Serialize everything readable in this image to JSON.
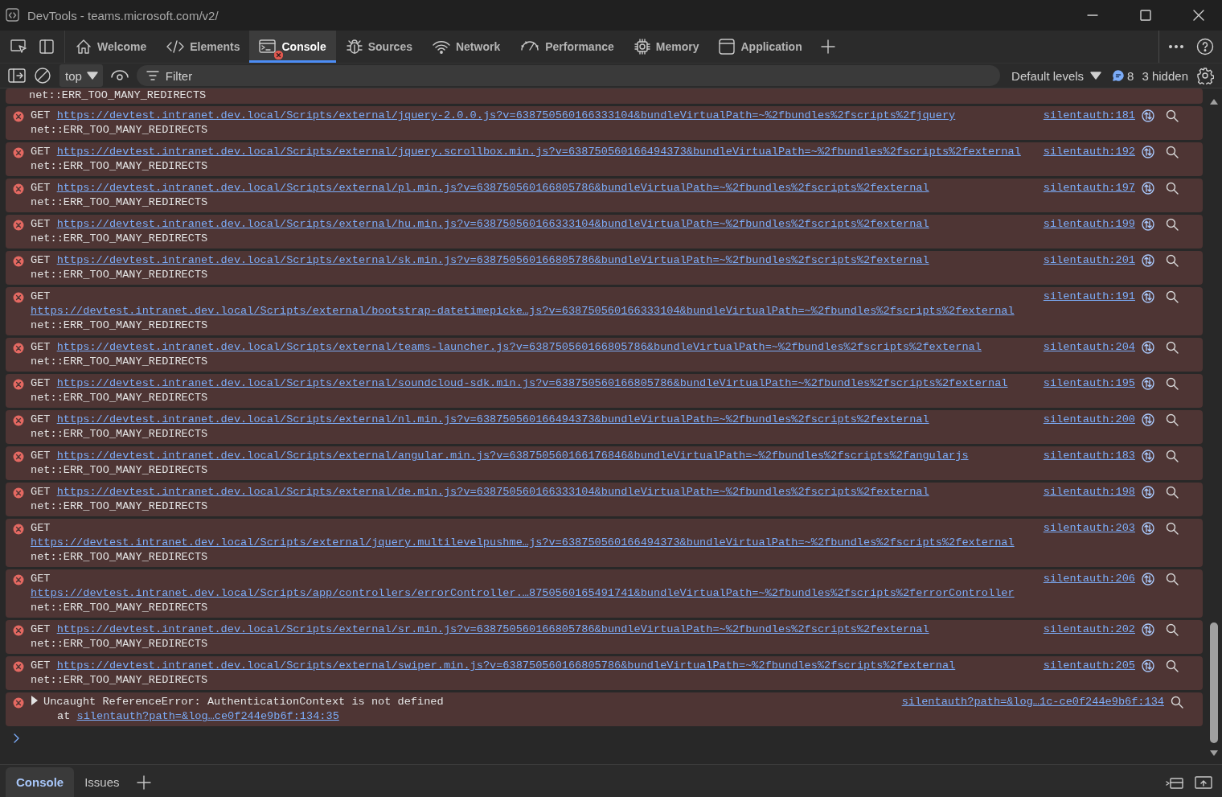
{
  "window": {
    "title": "DevTools - teams.microsoft.com/v2/"
  },
  "tabs": [
    {
      "label": "Welcome",
      "selected": false,
      "has_errors": false
    },
    {
      "label": "Elements",
      "selected": false,
      "has_errors": false
    },
    {
      "label": "Console",
      "selected": true,
      "has_errors": true
    },
    {
      "label": "Sources",
      "selected": false,
      "has_errors": false
    },
    {
      "label": "Network",
      "selected": false,
      "has_errors": false
    },
    {
      "label": "Performance",
      "selected": false,
      "has_errors": false
    },
    {
      "label": "Memory",
      "selected": false,
      "has_errors": false
    },
    {
      "label": "Application",
      "selected": false,
      "has_errors": false
    }
  ],
  "toolbar": {
    "context": "top",
    "filter_placeholder": "Filter",
    "levels": "Default levels",
    "message_count": "8",
    "hidden": "3 hidden"
  },
  "clipped_entry": {
    "error": "net::ERR_TOO_MANY_REDIRECTS"
  },
  "messages": [
    {
      "kind": "network_error",
      "method": "GET",
      "url": "https://devtest.intranet.dev.local/Scripts/external/jquery-2.0.0.js?v=638750560166333104&bundleVirtualPath=~%2fbundles%2fscripts%2fjquery",
      "error": "net::ERR_TOO_MANY_REDIRECTS",
      "source": "silentauth:181"
    },
    {
      "kind": "network_error",
      "method": "GET",
      "url": "https://devtest.intranet.dev.local/Scripts/external/jquery.scrollbox.min.js?v=638750560166494373&bundleVirtualPath=~%2fbundles%2fscripts%2fexternal",
      "error": "net::ERR_TOO_MANY_REDIRECTS",
      "source": "silentauth:192"
    },
    {
      "kind": "network_error",
      "method": "GET",
      "url": "https://devtest.intranet.dev.local/Scripts/external/pl.min.js?v=638750560166805786&bundleVirtualPath=~%2fbundles%2fscripts%2fexternal",
      "error": "net::ERR_TOO_MANY_REDIRECTS",
      "source": "silentauth:197"
    },
    {
      "kind": "network_error",
      "method": "GET",
      "url": "https://devtest.intranet.dev.local/Scripts/external/hu.min.js?v=638750560166333104&bundleVirtualPath=~%2fbundles%2fscripts%2fexternal",
      "error": "net::ERR_TOO_MANY_REDIRECTS",
      "source": "silentauth:199"
    },
    {
      "kind": "network_error",
      "method": "GET",
      "url": "https://devtest.intranet.dev.local/Scripts/external/sk.min.js?v=638750560166805786&bundleVirtualPath=~%2fbundles%2fscripts%2fexternal",
      "error": "net::ERR_TOO_MANY_REDIRECTS",
      "source": "silentauth:201"
    },
    {
      "kind": "network_error",
      "method": "GET",
      "url": "https://devtest.intranet.dev.local/Scripts/external/bootstrap-datetimepicke…js?v=638750560166333104&bundleVirtualPath=~%2fbundles%2fscripts%2fexternal",
      "error": "net::ERR_TOO_MANY_REDIRECTS",
      "source": "silentauth:191"
    },
    {
      "kind": "network_error",
      "method": "GET",
      "url": "https://devtest.intranet.dev.local/Scripts/external/teams-launcher.js?v=638750560166805786&bundleVirtualPath=~%2fbundles%2fscripts%2fexternal",
      "error": "net::ERR_TOO_MANY_REDIRECTS",
      "source": "silentauth:204"
    },
    {
      "kind": "network_error",
      "method": "GET",
      "url": "https://devtest.intranet.dev.local/Scripts/external/soundcloud-sdk.min.js?v=638750560166805786&bundleVirtualPath=~%2fbundles%2fscripts%2fexternal",
      "error": "net::ERR_TOO_MANY_REDIRECTS",
      "source": "silentauth:195"
    },
    {
      "kind": "network_error",
      "method": "GET",
      "url": "https://devtest.intranet.dev.local/Scripts/external/nl.min.js?v=638750560166494373&bundleVirtualPath=~%2fbundles%2fscripts%2fexternal",
      "error": "net::ERR_TOO_MANY_REDIRECTS",
      "source": "silentauth:200"
    },
    {
      "kind": "network_error",
      "method": "GET",
      "url": "https://devtest.intranet.dev.local/Scripts/external/angular.min.js?v=638750560166176846&bundleVirtualPath=~%2fbundles%2fscripts%2fangularjs",
      "error": "net::ERR_TOO_MANY_REDIRECTS",
      "source": "silentauth:183"
    },
    {
      "kind": "network_error",
      "method": "GET",
      "url": "https://devtest.intranet.dev.local/Scripts/external/de.min.js?v=638750560166333104&bundleVirtualPath=~%2fbundles%2fscripts%2fexternal",
      "error": "net::ERR_TOO_MANY_REDIRECTS",
      "source": "silentauth:198"
    },
    {
      "kind": "network_error",
      "method": "GET",
      "url": "https://devtest.intranet.dev.local/Scripts/external/jquery.multilevelpushme…js?v=638750560166494373&bundleVirtualPath=~%2fbundles%2fscripts%2fexternal",
      "error": "net::ERR_TOO_MANY_REDIRECTS",
      "source": "silentauth:203"
    },
    {
      "kind": "network_error",
      "method": "GET",
      "url": "https://devtest.intranet.dev.local/Scripts/app/controllers/errorController.…8750560165491741&bundleVirtualPath=~%2fbundles%2fscripts%2ferrorController",
      "error": "net::ERR_TOO_MANY_REDIRECTS",
      "source": "silentauth:206"
    },
    {
      "kind": "network_error",
      "method": "GET",
      "url": "https://devtest.intranet.dev.local/Scripts/external/sr.min.js?v=638750560166805786&bundleVirtualPath=~%2fbundles%2fscripts%2fexternal",
      "error": "net::ERR_TOO_MANY_REDIRECTS",
      "source": "silentauth:202"
    },
    {
      "kind": "network_error",
      "method": "GET",
      "url": "https://devtest.intranet.dev.local/Scripts/external/swiper.min.js?v=638750560166805786&bundleVirtualPath=~%2fbundles%2fscripts%2fexternal",
      "error": "net::ERR_TOO_MANY_REDIRECTS",
      "source": "silentauth:205"
    },
    {
      "kind": "exception",
      "expanded": false,
      "message": "Uncaught ReferenceError: AuthenticationContext is not defined",
      "at": "at",
      "at_link": "silentauth?path=&log…ce0f244e9b6f:134:35",
      "source": "silentauth?path=&log…1c-ce0f244e9b6f:134"
    }
  ],
  "drawer_tabs": [
    {
      "label": "Console",
      "selected": true
    },
    {
      "label": "Issues",
      "selected": false
    }
  ]
}
